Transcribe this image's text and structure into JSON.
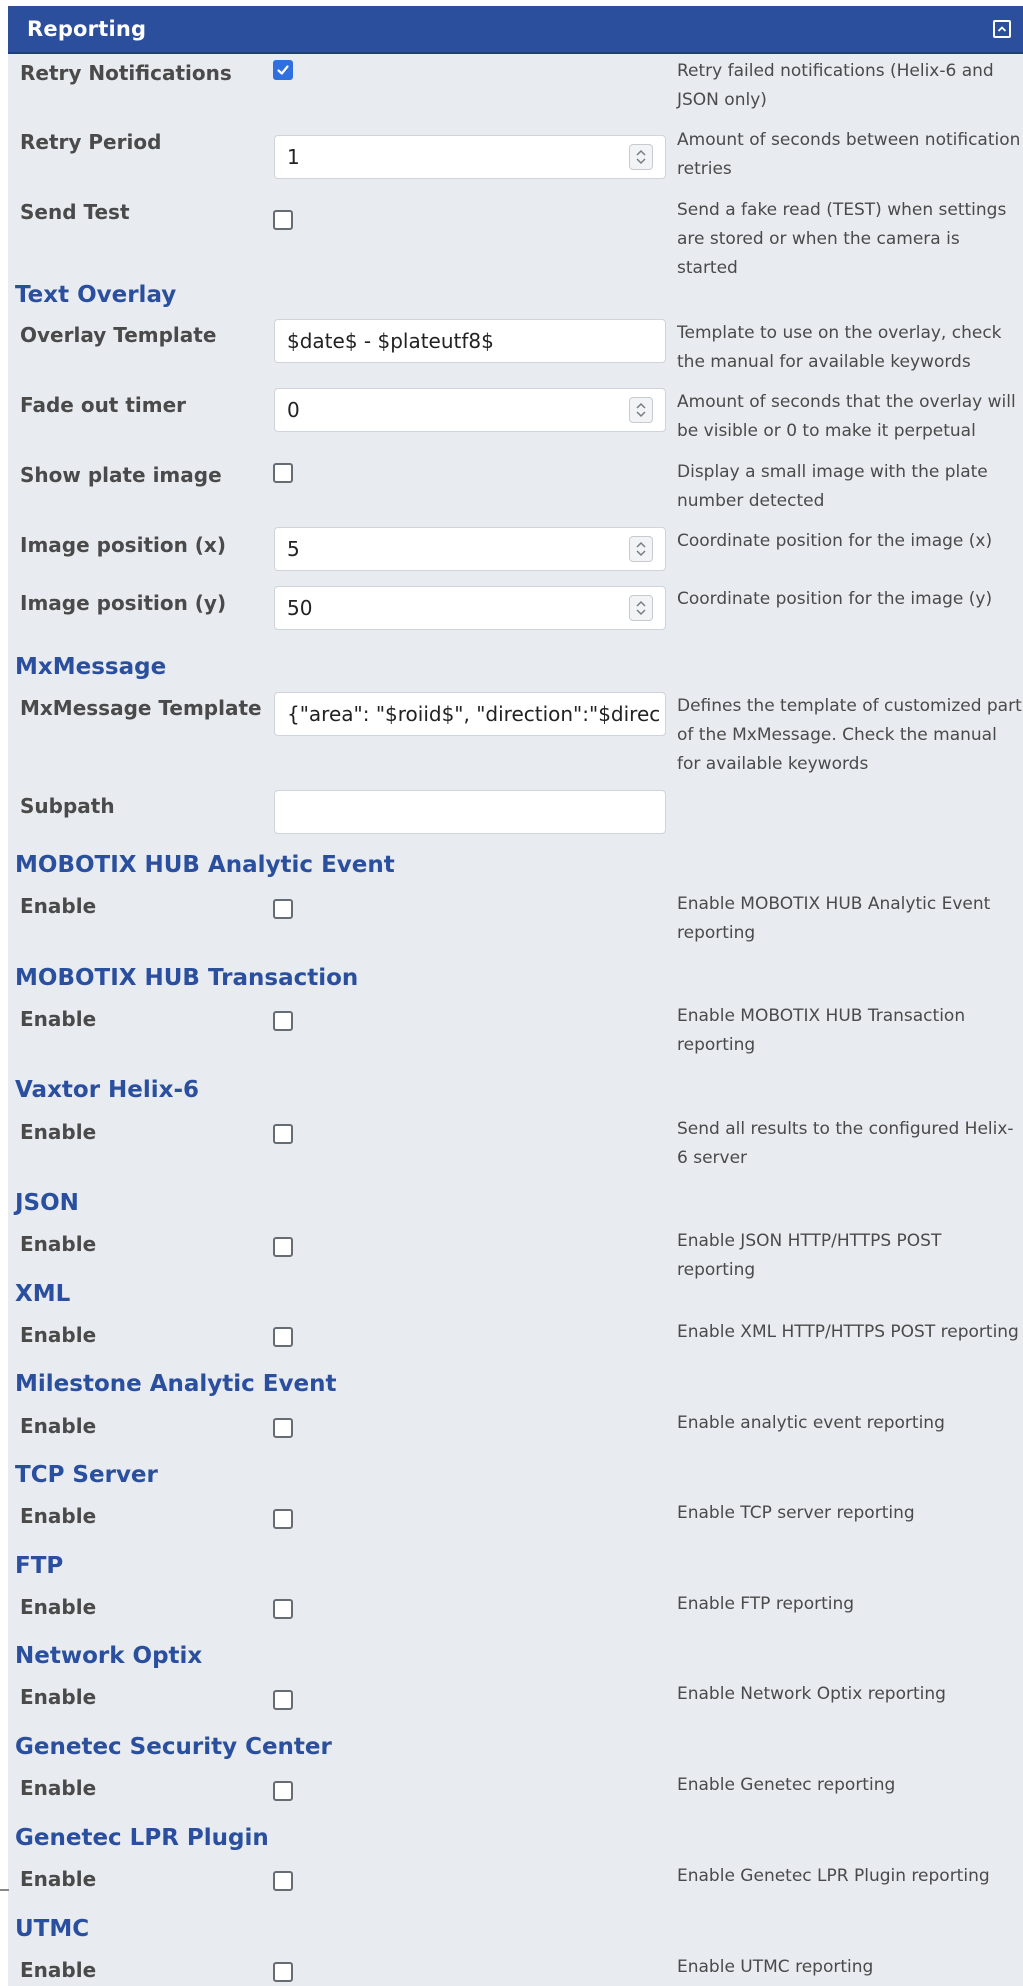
{
  "header": {
    "title": "Reporting",
    "collapse_icon": "chevron-up-box-icon"
  },
  "reporting": {
    "retry_notifications": {
      "label": "Retry Notifications",
      "checked": true,
      "desc": "Retry failed notifications (Helix-6 and JSON only)"
    },
    "retry_period": {
      "label": "Retry Period",
      "value": "1",
      "desc": "Amount of seconds between notification retries"
    },
    "send_test": {
      "label": "Send Test",
      "checked": false,
      "desc": "Send a fake read (TEST) when settings are stored or when the camera is started"
    }
  },
  "text_overlay": {
    "title": "Text Overlay",
    "template": {
      "label": "Overlay Template",
      "value": "$date$ - $plateutf8$",
      "desc": "Template to use on the overlay, check the manual for available keywords"
    },
    "fade": {
      "label": "Fade out timer",
      "value": "0",
      "desc": "Amount of seconds that the overlay will be visible or 0 to make it perpetual"
    },
    "show_plate": {
      "label": "Show plate image",
      "checked": false,
      "desc": "Display a small image with the plate number detected"
    },
    "pos_x": {
      "label": "Image position (x)",
      "value": "5",
      "desc": "Coordinate position for the image (x)"
    },
    "pos_y": {
      "label": "Image position (y)",
      "value": "50",
      "desc": "Coordinate position for the image (y)"
    }
  },
  "mxmessage": {
    "title": "MxMessage",
    "template": {
      "label": "MxMessage Template",
      "value": "{\"area\": \"$roiid$\", \"direction\":\"$direc",
      "desc": "Defines the template of customized part of the MxMessage. Check the manual for available keywords"
    },
    "subpath": {
      "label": "Subpath",
      "value": ""
    }
  },
  "sections": [
    {
      "title": "MOBOTIX HUB Analytic Event",
      "label": "Enable",
      "desc": "Enable MOBOTIX HUB Analytic Event reporting"
    },
    {
      "title": "MOBOTIX HUB Transaction",
      "label": "Enable",
      "desc": "Enable MOBOTIX HUB Transaction reporting"
    },
    {
      "title": "Vaxtor Helix-6",
      "label": "Enable",
      "desc": "Send all results to the configured Helix-6 server"
    },
    {
      "title": "JSON",
      "label": "Enable",
      "desc": "Enable JSON HTTP/HTTPS POST reporting"
    },
    {
      "title": "XML",
      "label": "Enable",
      "desc": "Enable XML HTTP/HTTPS POST reporting"
    },
    {
      "title": "Milestone Analytic Event",
      "label": "Enable",
      "desc": "Enable analytic event reporting"
    },
    {
      "title": "TCP Server",
      "label": "Enable",
      "desc": "Enable TCP server reporting"
    },
    {
      "title": "FTP",
      "label": "Enable",
      "desc": "Enable FTP reporting"
    },
    {
      "title": "Network Optix",
      "label": "Enable",
      "desc": "Enable Network Optix reporting"
    },
    {
      "title": "Genetec Security Center",
      "label": "Enable",
      "desc": "Enable Genetec reporting"
    },
    {
      "title": "Genetec LPR Plugin",
      "label": "Enable",
      "desc": "Enable Genetec LPR Plugin reporting"
    },
    {
      "title": "UTMC",
      "label": "Enable",
      "desc": "Enable UTMC reporting"
    }
  ],
  "colors": {
    "header_bg": "#2b4f9c",
    "section_title": "#2a4f9e",
    "panel_bg": "#e8ebef",
    "checkbox_accent": "#2f6fdf"
  }
}
